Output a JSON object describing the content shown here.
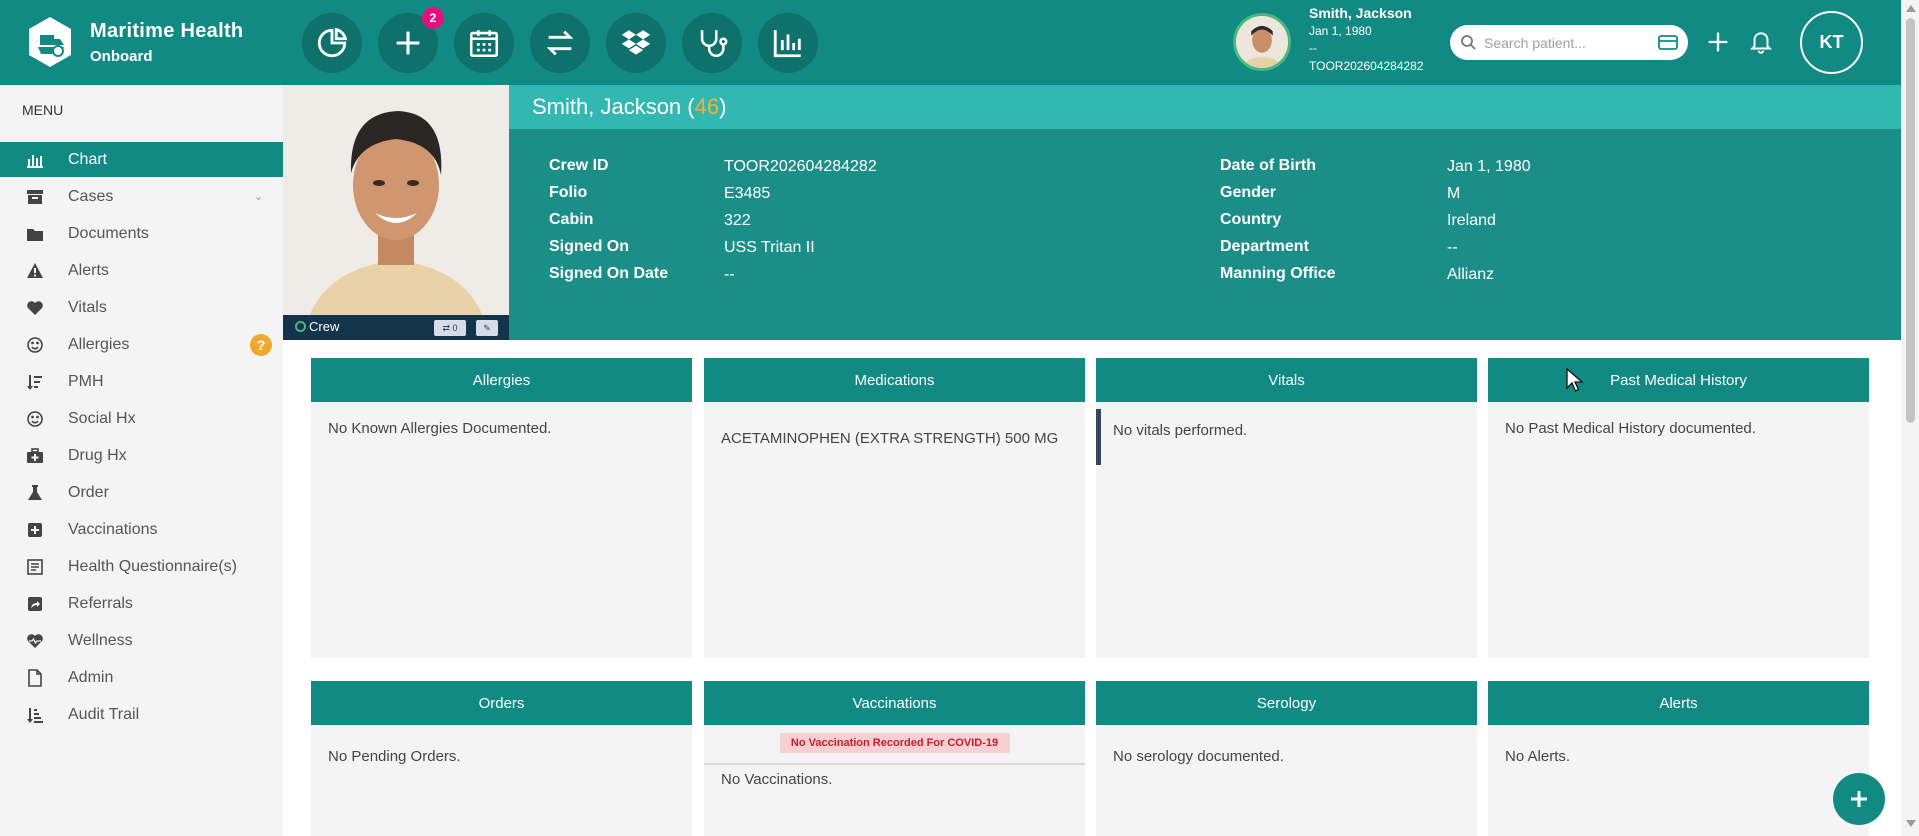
{
  "brand": {
    "title": "Maritime Health",
    "subtitle": "Onboard"
  },
  "nav": {
    "badge_count": "2"
  },
  "patient_header": {
    "name": "Smith, Jackson",
    "dob": "Jan 1, 1980",
    "dash": "--",
    "crew_id": "TOOR202604284282"
  },
  "search": {
    "placeholder": "Search patient..."
  },
  "user": {
    "initials": "KT"
  },
  "sidebar": {
    "menu_label": "MENU",
    "items": [
      {
        "label": "Chart"
      },
      {
        "label": "Cases"
      },
      {
        "label": "Documents"
      },
      {
        "label": "Alerts"
      },
      {
        "label": "Vitals"
      },
      {
        "label": "Allergies"
      },
      {
        "label": "PMH"
      },
      {
        "label": "Social Hx"
      },
      {
        "label": "Drug Hx"
      },
      {
        "label": "Order"
      },
      {
        "label": "Vaccinations"
      },
      {
        "label": "Health Questionnaire(s)"
      },
      {
        "label": "Referrals"
      },
      {
        "label": "Wellness"
      },
      {
        "label": "Admin"
      },
      {
        "label": "Audit Trail"
      }
    ],
    "allergies_badge": "?"
  },
  "photo_bar": {
    "crew_label": "Crew",
    "share_count": "0"
  },
  "banner": {
    "name": "Smith, Jackson",
    "age": "46",
    "left_fields": [
      {
        "label": "Crew ID",
        "value": "TOOR202604284282"
      },
      {
        "label": "Folio",
        "value": "E3485"
      },
      {
        "label": "Cabin",
        "value": "322"
      },
      {
        "label": "Signed On",
        "value": "USS Tritan II"
      },
      {
        "label": "Signed On Date",
        "value": "--"
      }
    ],
    "right_fields": [
      {
        "label": "Date of Birth",
        "value": "Jan 1, 1980"
      },
      {
        "label": "Gender",
        "value": "M"
      },
      {
        "label": "Country",
        "value": "Ireland"
      },
      {
        "label": "Department",
        "value": "--"
      },
      {
        "label": "Manning Office",
        "value": "Allianz"
      }
    ]
  },
  "cards": {
    "allergies": {
      "title": "Allergies",
      "body": "No Known Allergies Documented."
    },
    "medications": {
      "title": "Medications",
      "body": "ACETAMINOPHEN (EXTRA STRENGTH) 500 MG"
    },
    "vitals": {
      "title": "Vitals",
      "body": "No vitals performed."
    },
    "pmh": {
      "title": "Past Medical History",
      "body": "No Past Medical History documented."
    },
    "orders": {
      "title": "Orders",
      "body": "No Pending Orders."
    },
    "vaccinations": {
      "title": "Vaccinations",
      "alert": "No Vaccination Recorded For COVID-19",
      "body": "No Vaccinations."
    },
    "serology": {
      "title": "Serology",
      "body": "No serology documented."
    },
    "alerts": {
      "title": "Alerts",
      "body": "No Alerts."
    }
  },
  "colors": {
    "primary": "#128a84",
    "banner": "#1c8e88",
    "name_bar": "#33b8b1",
    "badge": "#e4107e",
    "age": "#f0b040"
  }
}
